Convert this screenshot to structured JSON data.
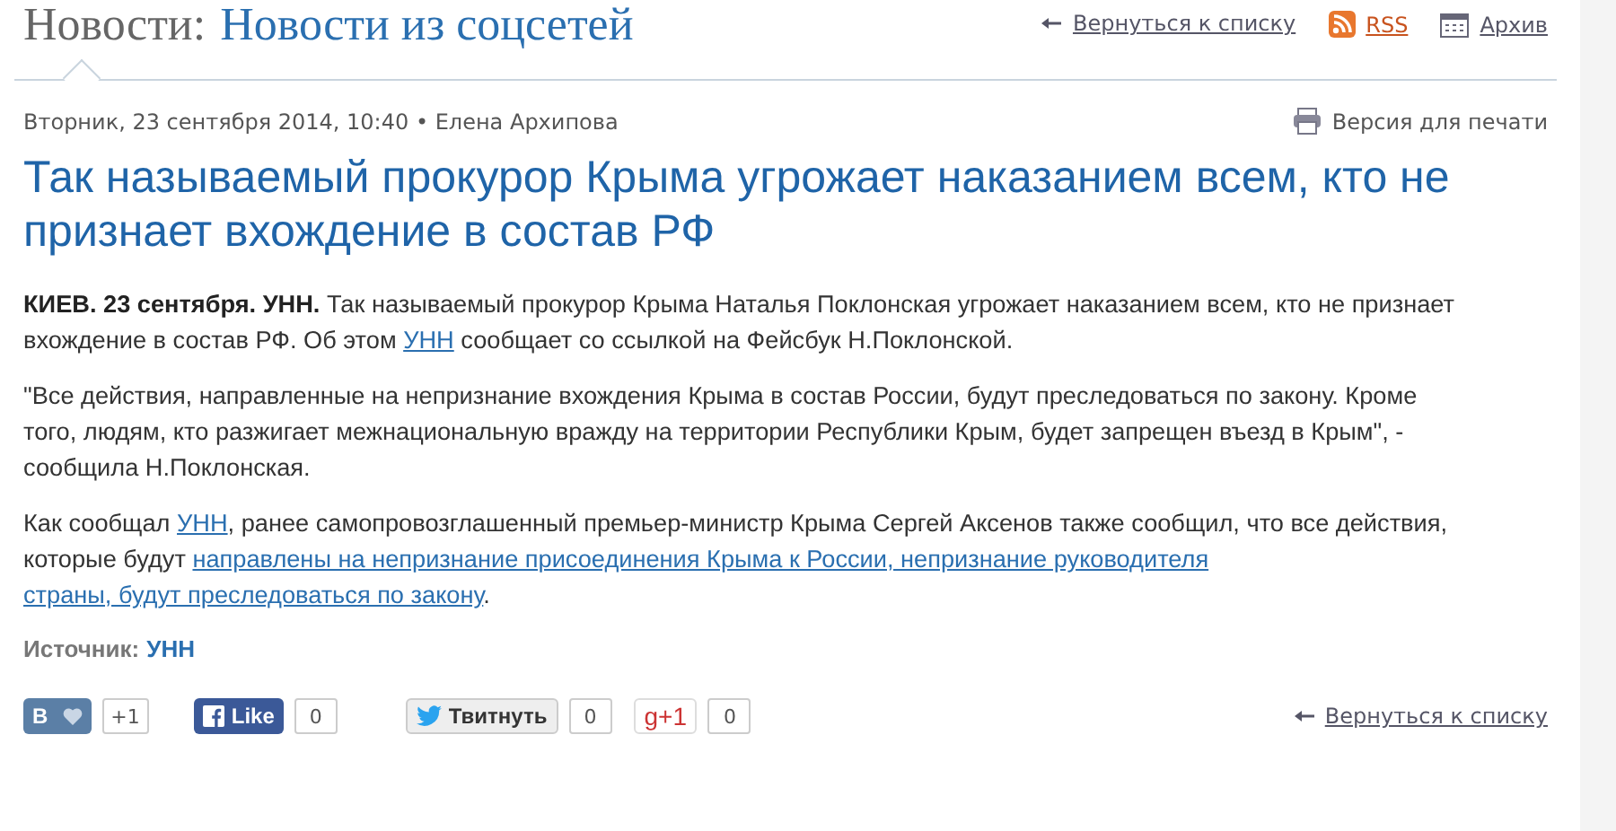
{
  "section": {
    "label": "Новости:",
    "link": "Новости из соцсетей"
  },
  "header_links": [
    {
      "kind": "back",
      "label": "Вернуться к списку"
    },
    {
      "kind": "rss",
      "label": "RSS"
    },
    {
      "kind": "archive",
      "label": "Архив"
    }
  ],
  "byline": "Вторник, 23 сентября 2014, 10:40 • Елена Архипова",
  "print_link": "Версия для печати",
  "headline": "Так называемый прокурор Крыма угрожает наказанием всем, кто не признает вхождение в состав РФ",
  "paragraphs": [
    [
      {
        "kind": "bold",
        "text": "КИЕВ. 23 сентября. УНН."
      },
      {
        "kind": "text",
        "text": " Так называемый прокурор Крыма Наталья Поклонская угрожает наказанием всем, кто не признает вхождение в состав РФ. Об этом "
      },
      {
        "kind": "link",
        "text": "УНН"
      },
      {
        "kind": "text",
        "text": " сообщает со ссылкой на Фейсбук Н.Поклонской."
      }
    ],
    [
      {
        "kind": "text",
        "text": "\"Все действия, направленные на непризнание вхождения Крыма в состав России, будут преследоваться по закону. Кроме того, людям, кто разжигает межнациональную вражду на территории Республики Крым, будет запрещен въезд в Крым\", - сообщила Н.Поклонская."
      }
    ],
    [
      {
        "kind": "text",
        "text": "Как сообщал "
      },
      {
        "kind": "link",
        "text": "УНН"
      },
      {
        "kind": "text",
        "text": ", ранее самопровозглашенный премьер-министр Крыма Сергей Аксенов также сообщил, что все действия, которые будут "
      },
      {
        "kind": "link",
        "text": "направлены на непризнание присоединения Крыма к России, непризнание руководителя"
      },
      {
        "kind": "space"
      },
      {
        "kind": "link",
        "text": "страны, будут преследоваться по закону"
      },
      {
        "kind": "text",
        "text": "."
      }
    ]
  ],
  "source": {
    "label": "Источник:",
    "value": "УНН"
  },
  "social": [
    {
      "kind": "vk",
      "label": "В",
      "count": "+1"
    },
    {
      "kind": "facebook",
      "label": "Like",
      "count": "0"
    },
    {
      "kind": "twitter",
      "label": "Твитнуть",
      "count": "0"
    },
    {
      "kind": "gplus",
      "label": "g+1",
      "count": "0"
    }
  ],
  "bottom_link": "Вернуться к списку"
}
